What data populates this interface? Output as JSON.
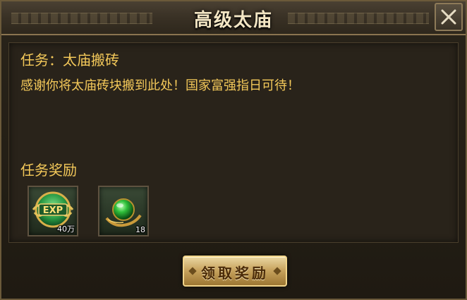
{
  "dialog": {
    "title": "高级太庙",
    "close_icon": "close-icon"
  },
  "task": {
    "title": "任务：太庙搬砖",
    "description": "感谢你将太庙砖块搬到此处！国家富强指日可待！"
  },
  "rewards": {
    "heading": "任务奖励",
    "items": [
      {
        "icon": "exp-icon",
        "quantity": "40万"
      },
      {
        "icon": "green-jade-orb-icon",
        "quantity": "18"
      }
    ]
  },
  "claim_button": {
    "label": "领取奖励"
  },
  "colors": {
    "accent_text": "#f4c95a",
    "title_text": "#f3e6c4",
    "button_gold": "#c9a560"
  }
}
